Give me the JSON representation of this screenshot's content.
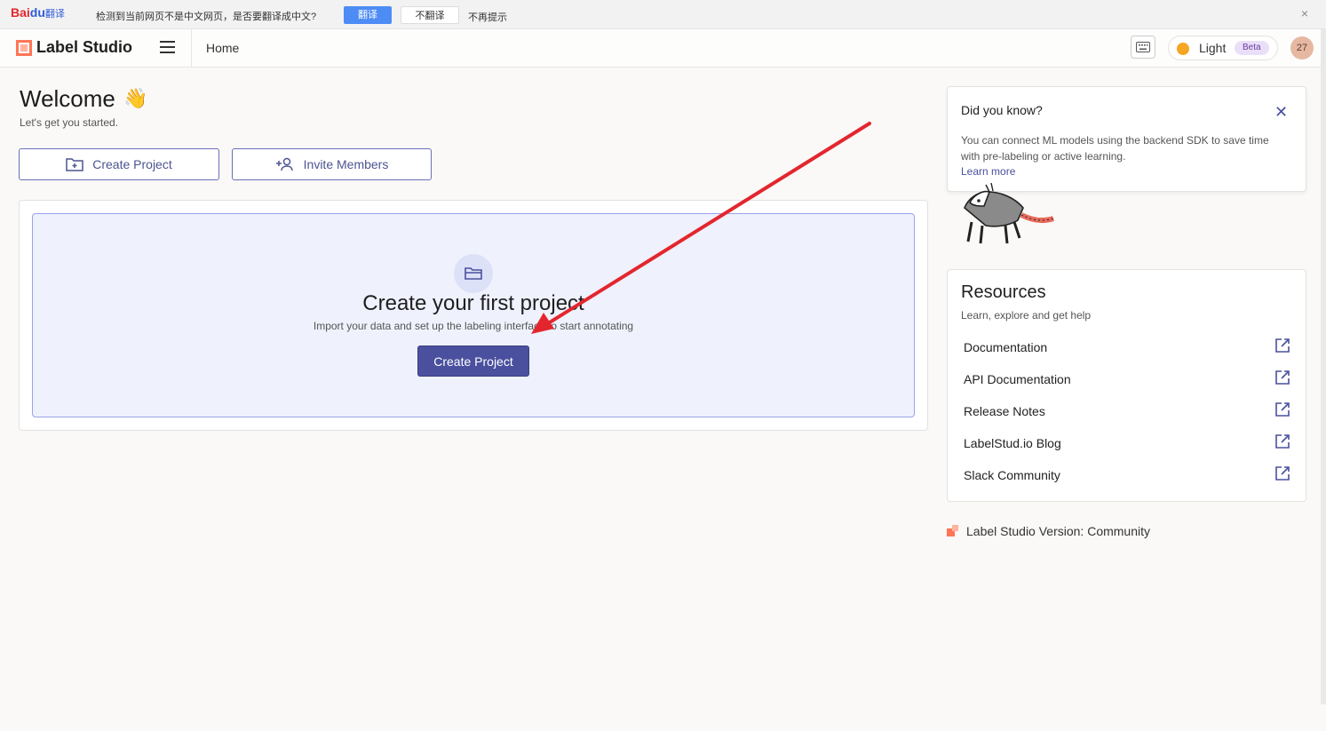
{
  "translate_bar": {
    "logo_text": "Bai",
    "logo_paw": "du",
    "logo_suffix": "翻译",
    "message": "检测到当前网页不是中文网页，是否要翻译成中文?",
    "translate_label": "翻译",
    "no_translate_label": "不翻译",
    "no_more_label": "不再提示",
    "close_glyph": "×"
  },
  "header": {
    "brand": "Label Studio",
    "breadcrumb": "Home",
    "theme_label": "Light",
    "theme_badge": "Beta",
    "avatar_initials": "27"
  },
  "welcome": {
    "title": "Welcome",
    "emoji": "👋",
    "subtitle": "Let's get you started.",
    "create_project_label": "Create Project",
    "invite_members_label": "Invite Members"
  },
  "empty_state": {
    "title": "Create your first project",
    "subtitle": "Import your data and set up the labeling interface to start annotating",
    "button_label": "Create Project"
  },
  "tip": {
    "title": "Did you know?",
    "body": "You can connect ML models using the backend SDK to save time with pre-labeling or active learning.",
    "link": "Learn more",
    "close_glyph": "✕"
  },
  "resources": {
    "title": "Resources",
    "subtitle": "Learn, explore and get help",
    "items": [
      {
        "label": "Documentation"
      },
      {
        "label": "API Documentation"
      },
      {
        "label": "Release Notes"
      },
      {
        "label": "LabelStud.io Blog"
      },
      {
        "label": "Slack Community"
      }
    ]
  },
  "version": "Label Studio Version: Community",
  "colors": {
    "accent": "#4a509e",
    "brand_orange": "#ff7557",
    "annotation_arrow": "#e3262e"
  }
}
